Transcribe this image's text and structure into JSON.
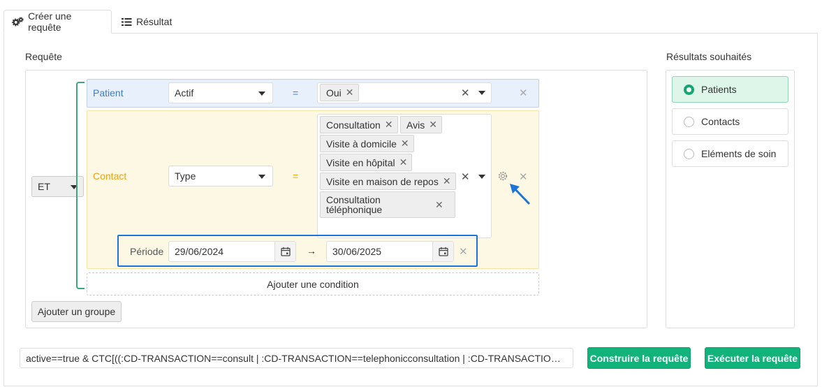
{
  "tabs": [
    {
      "label": "Créer une requête",
      "icon": "gears-icon",
      "active": true
    },
    {
      "label": "Résultat",
      "icon": "list-icon",
      "active": false
    }
  ],
  "query": {
    "label": "Requête",
    "group_operator": "ET",
    "rows": [
      {
        "entity": "Patient",
        "field": "Actif",
        "operator": "=",
        "values": [
          "Oui"
        ]
      },
      {
        "entity": "Contact",
        "field": "Type",
        "operator": "=",
        "values": [
          "Consultation",
          "Avis",
          "Visite à domicile",
          "Visite en hôpital",
          "Visite en maison de repos",
          "Consultation téléphonique"
        ],
        "period": {
          "label": "Période",
          "from": "29/06/2024",
          "arrow": "→",
          "to": "30/06/2025"
        }
      }
    ],
    "add_condition_label": "Ajouter une condition",
    "add_group_label": "Ajouter un groupe"
  },
  "results": {
    "label": "Résultats souhaités",
    "options": [
      {
        "label": "Patients",
        "selected": true
      },
      {
        "label": "Contacts",
        "selected": false
      },
      {
        "label": "Eléments de soin",
        "selected": false
      }
    ]
  },
  "footer": {
    "query_string": "active==true & CTC[((:CD-TRANSACTION==consult | :CD-TRANSACTION==telephonicconsultation | :CD-TRANSACTION==ho...",
    "build_label": "Construire la requête",
    "execute_label": "Exécuter la requête"
  },
  "colors": {
    "accent_green": "#12b27b",
    "patient_row": "#e8f0fb",
    "contact_row": "#fdf8e4",
    "highlight_blue": "#1b75d8",
    "patient_text": "#3f7fc7",
    "contact_text": "#e8a317"
  }
}
